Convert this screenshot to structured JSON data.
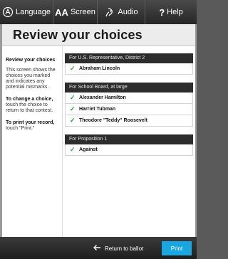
{
  "toolbar": {
    "language_label": "Language",
    "screen_prefix": "AA",
    "screen_label": "Screen",
    "audio_label": "Audio",
    "help_symbol": "?",
    "help_label": "Help"
  },
  "page": {
    "title": "Review your choices"
  },
  "sidebar": {
    "heading": "Review your choices",
    "intro": "This screen shows the choices you marked and indicates any potential mismarks.",
    "change_bold": "To change a choice,",
    "change_text": " touch the choice to return to that contest.",
    "print_bold": "To print your record,",
    "print_text": " touch \"Print.\""
  },
  "contests": [
    {
      "title": "For U.S. Representative, District 2",
      "choices": [
        "Abraham Lincoln"
      ]
    },
    {
      "title": "For School Board, at large",
      "choices": [
        "Alexander Hamilton",
        "Harriet Tubman",
        "Theodore \"Teddy\" Roosevelt"
      ]
    },
    {
      "title": "For Proposition 1",
      "choices": [
        "Against"
      ]
    }
  ],
  "check_symbol": "✓",
  "footer": {
    "return_label": "Return to ballot",
    "print_label": "Print"
  },
  "colors": {
    "accent": "#1aa6e0",
    "check": "#2f9e3e"
  }
}
